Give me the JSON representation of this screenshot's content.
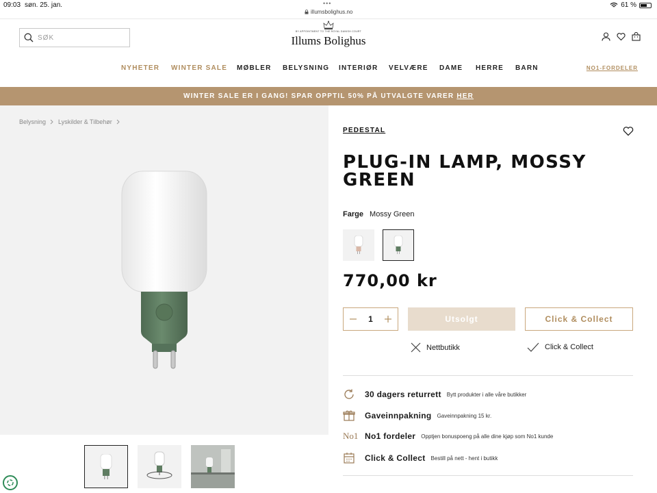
{
  "status_bar": {
    "time": "09:03",
    "date": "søn. 25. jan.",
    "dots": "•••",
    "url": "illumsbolighus.no",
    "battery": "61 %"
  },
  "header": {
    "search_placeholder": "SØK",
    "logo_crest_text": "BY APPOINTMENT TO THE ROYAL DANISH COURT",
    "logo_name": "Illums Bolighus"
  },
  "nav": {
    "items": [
      {
        "label": "NYHETER"
      },
      {
        "label": "WINTER SALE"
      },
      {
        "label": "MØBLER"
      },
      {
        "label": "BELYSNING"
      },
      {
        "label": "INTERIØR"
      },
      {
        "label": "VELVÆRE"
      },
      {
        "label": "DAME"
      },
      {
        "label": "HERRE"
      },
      {
        "label": "BARN"
      }
    ],
    "no1": "NO1-FORDELER"
  },
  "banner": {
    "text": "WINTER SALE ER I GANG! SPAR OPPTIL 50% PÅ UTVALGTE VARER",
    "link": "HER"
  },
  "breadcrumb": [
    "Belysning",
    "Lyskilder & Tilbehør"
  ],
  "product": {
    "brand": "PEDESTAL",
    "title": "PLUG-IN LAMP, MOSSY GREEN",
    "color_label": "Farge",
    "color_value": "Mossy Green",
    "price": "770,00 kr",
    "quantity": "1",
    "sold_out_label": "Utsolgt",
    "click_collect_label": "Click & Collect",
    "availability": [
      {
        "label": "Nettbutikk",
        "available": false
      },
      {
        "label": "Click & Collect",
        "available": true
      }
    ]
  },
  "benefits": [
    {
      "icon": "refresh-icon",
      "title": "30 dagers returrett",
      "desc": "Bytt produkter i alle våre butikker"
    },
    {
      "icon": "gift-icon",
      "title": "Gaveinnpakning",
      "desc": "Gaveinnpakning 15 kr."
    },
    {
      "icon": "no1-icon",
      "icon_text": "No1",
      "title": "No1 fordeler",
      "desc": "Opptjen bonuspoeng på alle dine kjøp som No1 kunde"
    },
    {
      "icon": "calendar-icon",
      "title": "Click & Collect",
      "desc": "Bestill på nett - hent i butikk"
    }
  ],
  "colors": {
    "accent": "#b08d5e",
    "banner": "#b59570",
    "lamp_green": "#5f7d62"
  }
}
